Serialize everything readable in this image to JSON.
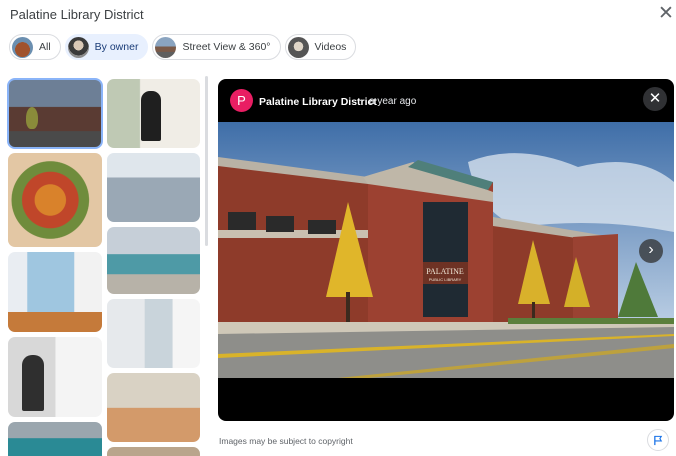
{
  "header": {
    "title": "Palatine Library District",
    "close_icon": "close-icon"
  },
  "filters": [
    {
      "label": "All",
      "active": false
    },
    {
      "label": "By owner",
      "active": true
    },
    {
      "label": "Street View & 360°",
      "active": false
    },
    {
      "label": "Videos",
      "active": false
    }
  ],
  "grid": {
    "tiles": [
      "library-exterior-photo",
      "person-in-library-photo",
      "autumn-floral-display-photo",
      "library-study-room-photo",
      "bulletin-board-photo",
      "library-children-area-photo",
      "staff-at-whiteboard-photo",
      "glass-partitions-photo",
      "community-screen-photo",
      "two-staff-holding-art-photo"
    ]
  },
  "viewer": {
    "avatar_letter": "P",
    "owner": "Palatine Library District",
    "separator": "·",
    "age": "a year ago",
    "building_sign": "PALATINE",
    "building_sign_sub": "PUBLIC LIBRARY"
  },
  "footer": {
    "copyright": "Images may be subject to copyright"
  },
  "colors": {
    "accent": "#1a73e8",
    "avatar": "#e91e63",
    "chip_active_bg": "#e8f0fe"
  }
}
